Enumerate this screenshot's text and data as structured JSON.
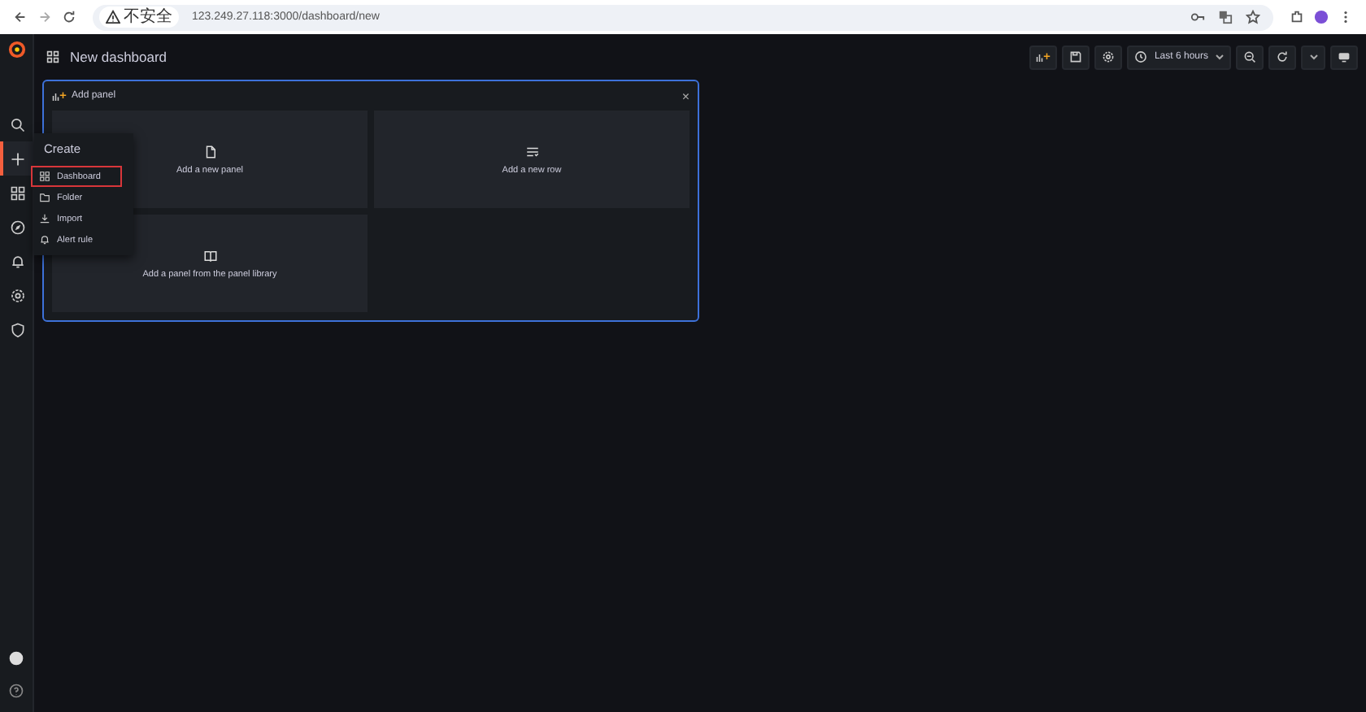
{
  "browser": {
    "security_label": "不安全",
    "url": "123.249.27.118:3000/dashboard/new"
  },
  "sidebar": {
    "items": [
      {
        "kind": "search",
        "selected": false
      },
      {
        "kind": "plus",
        "selected": true
      },
      {
        "kind": "apps",
        "selected": false
      },
      {
        "kind": "compass",
        "selected": false
      },
      {
        "kind": "bell",
        "selected": false
      },
      {
        "kind": "gear",
        "selected": false
      },
      {
        "kind": "shield",
        "selected": false
      }
    ]
  },
  "header": {
    "title": "New dashboard",
    "time_range": "Last 6 hours"
  },
  "create_menu": {
    "title": "Create",
    "items": [
      {
        "label": "Dashboard",
        "selected": true
      },
      {
        "label": "Folder",
        "selected": false
      },
      {
        "label": "Import",
        "selected": false
      },
      {
        "label": "Alert rule",
        "selected": false
      }
    ]
  },
  "add_panel": {
    "title": "Add panel",
    "close": "×",
    "options": [
      {
        "label": "Add a new panel"
      },
      {
        "label": "Add a new row"
      },
      {
        "label": "Add a panel from the panel library"
      }
    ]
  }
}
